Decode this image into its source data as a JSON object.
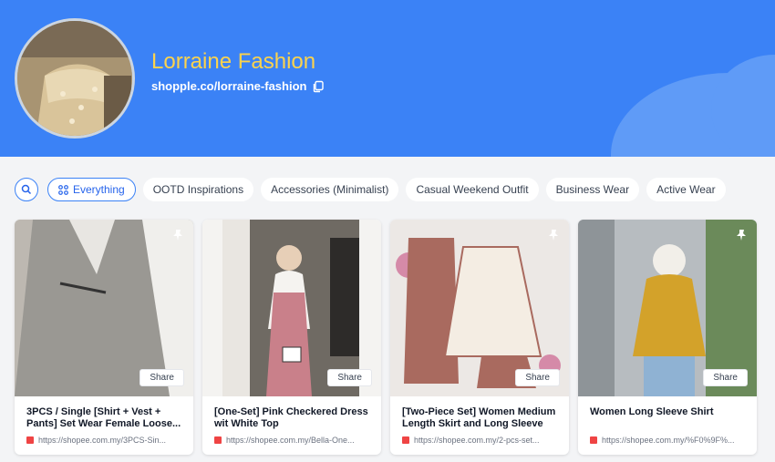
{
  "profile": {
    "name": "Lorraine Fashion",
    "url": "shopple.co/lorraine-fashion"
  },
  "filters": {
    "search_icon": "search-icon",
    "active": "Everything",
    "chips": [
      "OOTD Inspirations",
      "Accessories (Minimalist)",
      "Casual Weekend Outfit",
      "Business Wear",
      "Active Wear"
    ]
  },
  "products": [
    {
      "title": "3PCS / Single [Shirt + Vest + Pants] Set Wear Female Loose...",
      "link": "https://shopee.com.my/3PCS-Sin...",
      "share": "Share"
    },
    {
      "title": "[One-Set] Pink Checkered Dress wit White Top",
      "link": "https://shopee.com.my/Bella-One...",
      "share": "Share"
    },
    {
      "title": "[Two-Piece Set] Women Medium Length Skirt and Long Sleeve Top",
      "link": "https://shopee.com.my/2-pcs-set...",
      "share": "Share"
    },
    {
      "title": "Women Long Sleeve Shirt",
      "link": "https://shopee.com.my/%F0%9F%...",
      "share": "Share"
    }
  ],
  "colors": {
    "header": "#3b82f6",
    "name": "#fcd34d",
    "accent": "#2563eb"
  }
}
